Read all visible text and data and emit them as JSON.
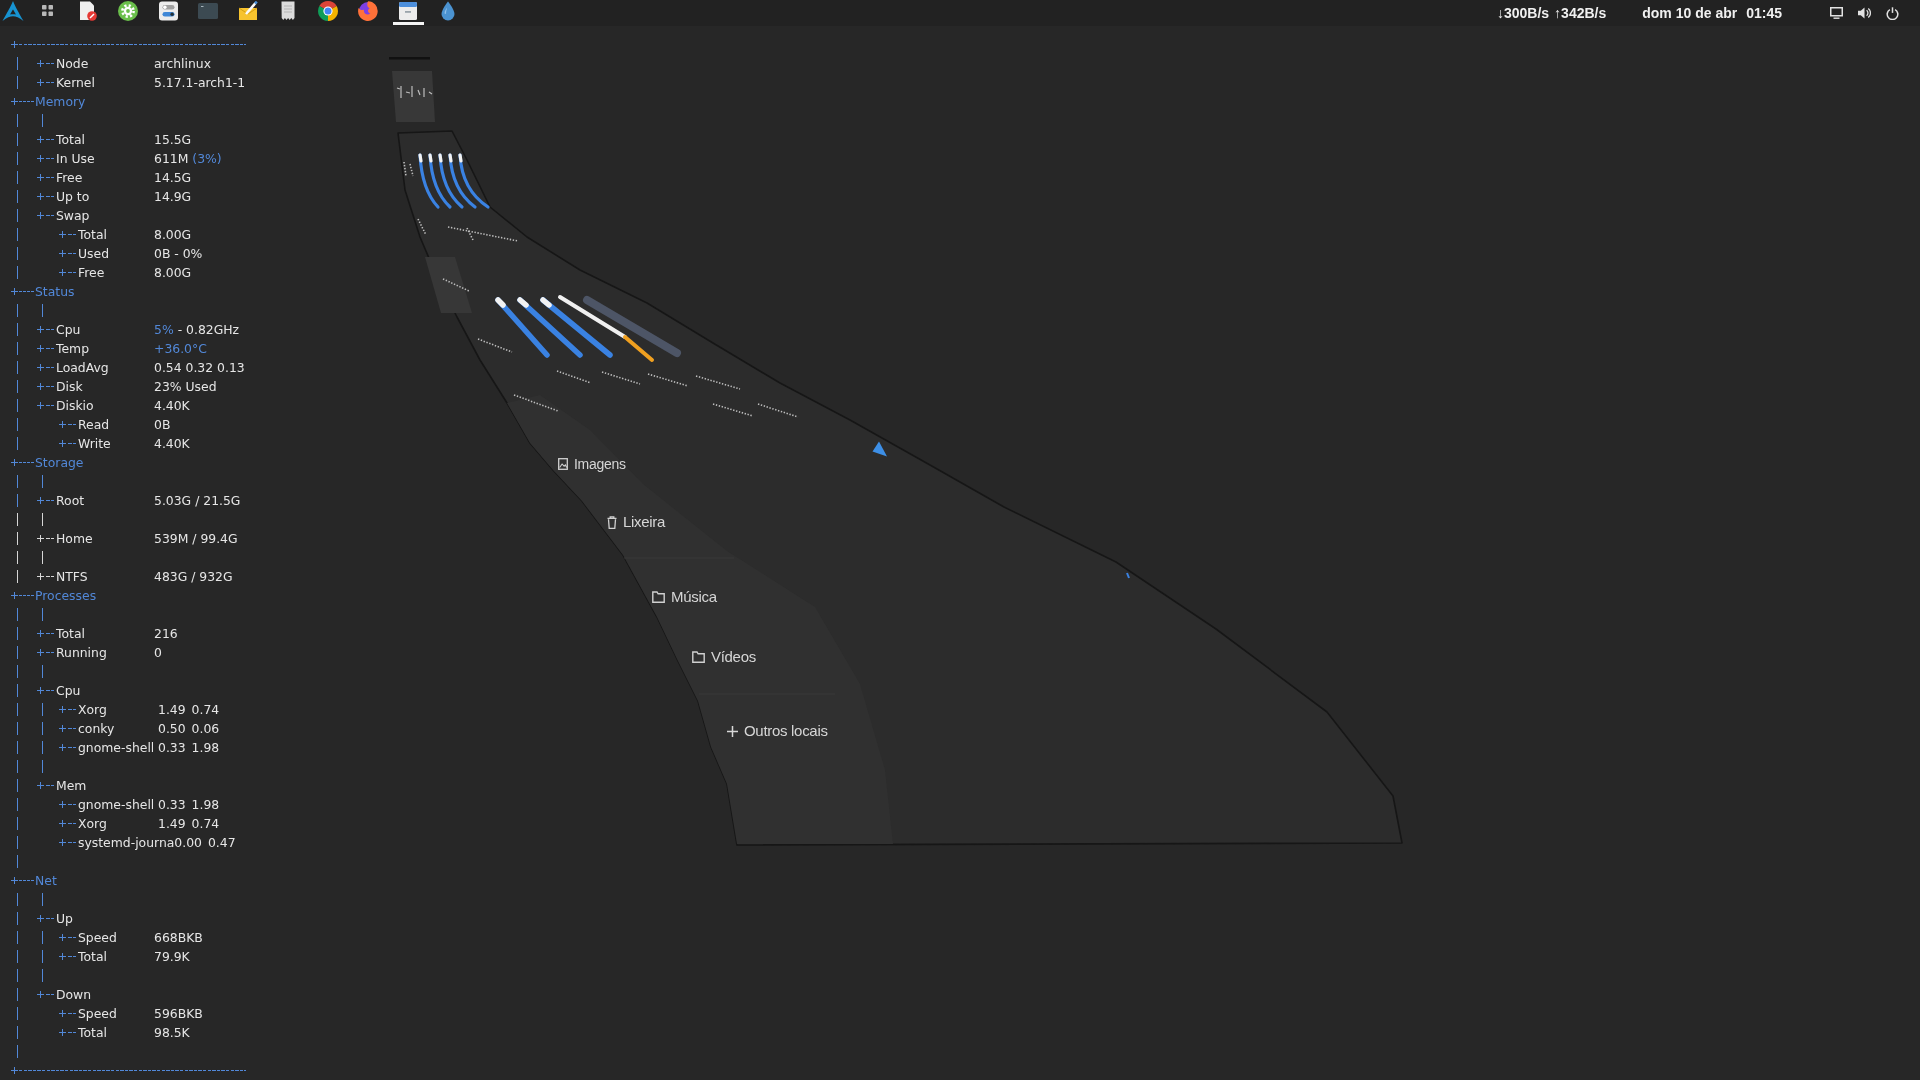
{
  "top_bar": {
    "launchers": [
      {
        "kind": "logo",
        "active": false
      },
      {
        "kind": "grid",
        "active": false
      },
      {
        "kind": "document",
        "active": false
      },
      {
        "kind": "gear",
        "active": false
      },
      {
        "kind": "toggles",
        "active": false
      },
      {
        "kind": "terminal",
        "active": false
      },
      {
        "kind": "notes",
        "active": false
      },
      {
        "kind": "sheet",
        "active": false
      },
      {
        "kind": "ring",
        "active": false
      },
      {
        "kind": "fox",
        "active": false
      },
      {
        "kind": "cabinet",
        "active": true
      },
      {
        "kind": "drop",
        "active": false
      }
    ],
    "net_down": "↓300B/s",
    "net_up": "↑342B/s",
    "date": "dom 10 de abr",
    "time": "01:45"
  },
  "conky": {
    "items": [
      {
        "kind": "entry",
        "label": "Node",
        "value": "archlinux"
      },
      {
        "kind": "entry",
        "label": "Kernel",
        "value": "5.17.1-arch1-1"
      },
      {
        "kind": "section",
        "label": "Memory",
        "children": [
          {
            "kind": "spacer"
          },
          {
            "kind": "entry",
            "label": "Total",
            "value": "15.5G"
          },
          {
            "kind": "entry",
            "label": "In Use",
            "value_parts": [
              {
                "text": "611M",
                "highlight": false
              },
              {
                "text": "(3%)",
                "highlight": true
              }
            ]
          },
          {
            "kind": "entry",
            "label": "Free",
            "value": "14.5G"
          },
          {
            "kind": "entry",
            "label": "Up to",
            "value": "14.9G"
          },
          {
            "kind": "entry",
            "label": "Swap",
            "children": [
              {
                "kind": "entry",
                "label": "Total",
                "value": "8.00G"
              },
              {
                "kind": "entry",
                "label": "Used",
                "value": "0B - 0%"
              },
              {
                "kind": "entry",
                "label": "Free",
                "value": "8.00G"
              }
            ]
          }
        ]
      },
      {
        "kind": "section",
        "label": "Status",
        "children": [
          {
            "kind": "spacer"
          },
          {
            "kind": "entry",
            "label": "Cpu",
            "value_parts": [
              {
                "text": "5%",
                "highlight": true
              },
              {
                "text": "- 0.82GHz",
                "highlight": false
              }
            ]
          },
          {
            "kind": "entry",
            "label": "Temp",
            "value_parts": [
              {
                "text": "+36.0°C",
                "highlight": true
              }
            ]
          },
          {
            "kind": "entry",
            "label": "LoadAvg",
            "value": "0.54 0.32 0.13"
          },
          {
            "kind": "entry",
            "label": "Disk",
            "value": "23% Used"
          },
          {
            "kind": "entry",
            "label": "Diskio",
            "value": "4.40K",
            "children": [
              {
                "kind": "entry",
                "label": "Read",
                "value": "0B"
              },
              {
                "kind": "entry",
                "label": "Write",
                "value": "4.40K"
              }
            ]
          }
        ]
      },
      {
        "kind": "section",
        "label": "Storage",
        "children": [
          {
            "kind": "spacer",
            "color": "#5288d8"
          },
          {
            "kind": "entry",
            "label": "Root",
            "value": "5.03G / 21.5G",
            "color": "#5288d8"
          },
          {
            "kind": "spacer",
            "color": "#d6d6d6"
          },
          {
            "kind": "entry",
            "label": "Home",
            "value": "539M / 99.4G",
            "color": "#d6d6d6"
          },
          {
            "kind": "spacer",
            "color": "#d6d6d6"
          },
          {
            "kind": "entry",
            "label": "NTFS",
            "value": "483G / 932G",
            "color": "#d6d6d6"
          }
        ]
      },
      {
        "kind": "section",
        "label": "Processes",
        "children": [
          {
            "kind": "spacer"
          },
          {
            "kind": "entry",
            "label": "Total",
            "value": "216"
          },
          {
            "kind": "entry",
            "label": "Running",
            "value": "0"
          },
          {
            "kind": "spacer"
          },
          {
            "kind": "entry",
            "label": "Cpu",
            "children": [
              {
                "kind": "process",
                "label": "Xorg",
                "values": [
                  "1.49",
                  "0.74"
                ]
              },
              {
                "kind": "process",
                "label": "conky",
                "values": [
                  "0.50",
                  "0.06"
                ]
              },
              {
                "kind": "process",
                "label": "gnome-shell",
                "values": [
                  "0.33",
                  "1.98"
                ]
              }
            ]
          },
          {
            "kind": "spacer"
          },
          {
            "kind": "entry",
            "label": "Mem",
            "children": [
              {
                "kind": "process",
                "label": "gnome-shell",
                "values": [
                  "0.33",
                  "1.98"
                ]
              },
              {
                "kind": "process",
                "label": "Xorg",
                "values": [
                  "1.49",
                  "0.74"
                ]
              },
              {
                "kind": "process",
                "label": "systemd-journa",
                "values": [
                  "0.00",
                  "0.47"
                ]
              }
            ]
          }
        ]
      },
      {
        "kind": "spacer"
      },
      {
        "kind": "section",
        "label": "Net",
        "children": [
          {
            "kind": "spacer"
          },
          {
            "kind": "entry",
            "label": "Up",
            "children": [
              {
                "kind": "entry",
                "label": "Speed",
                "value": "668BKB"
              },
              {
                "kind": "entry",
                "label": "Total",
                "value": "79.9K"
              }
            ]
          },
          {
            "kind": "spacer"
          },
          {
            "kind": "entry",
            "label": "Down",
            "children": [
              {
                "kind": "entry",
                "label": "Speed",
                "value": "596BKB"
              },
              {
                "kind": "entry",
                "label": "Total",
                "value": "98.5K"
              }
            ]
          }
        ]
      },
      {
        "kind": "spacer"
      }
    ]
  },
  "window": {
    "sidebar": [
      {
        "kind": "images",
        "label": "Imagens"
      },
      {
        "kind": "trash",
        "label": "Lixeira"
      },
      {
        "kind": "folder",
        "label": "Música"
      },
      {
        "kind": "folder",
        "label": "Vídeos"
      },
      {
        "kind": "add",
        "label": "Outros locais"
      }
    ]
  }
}
